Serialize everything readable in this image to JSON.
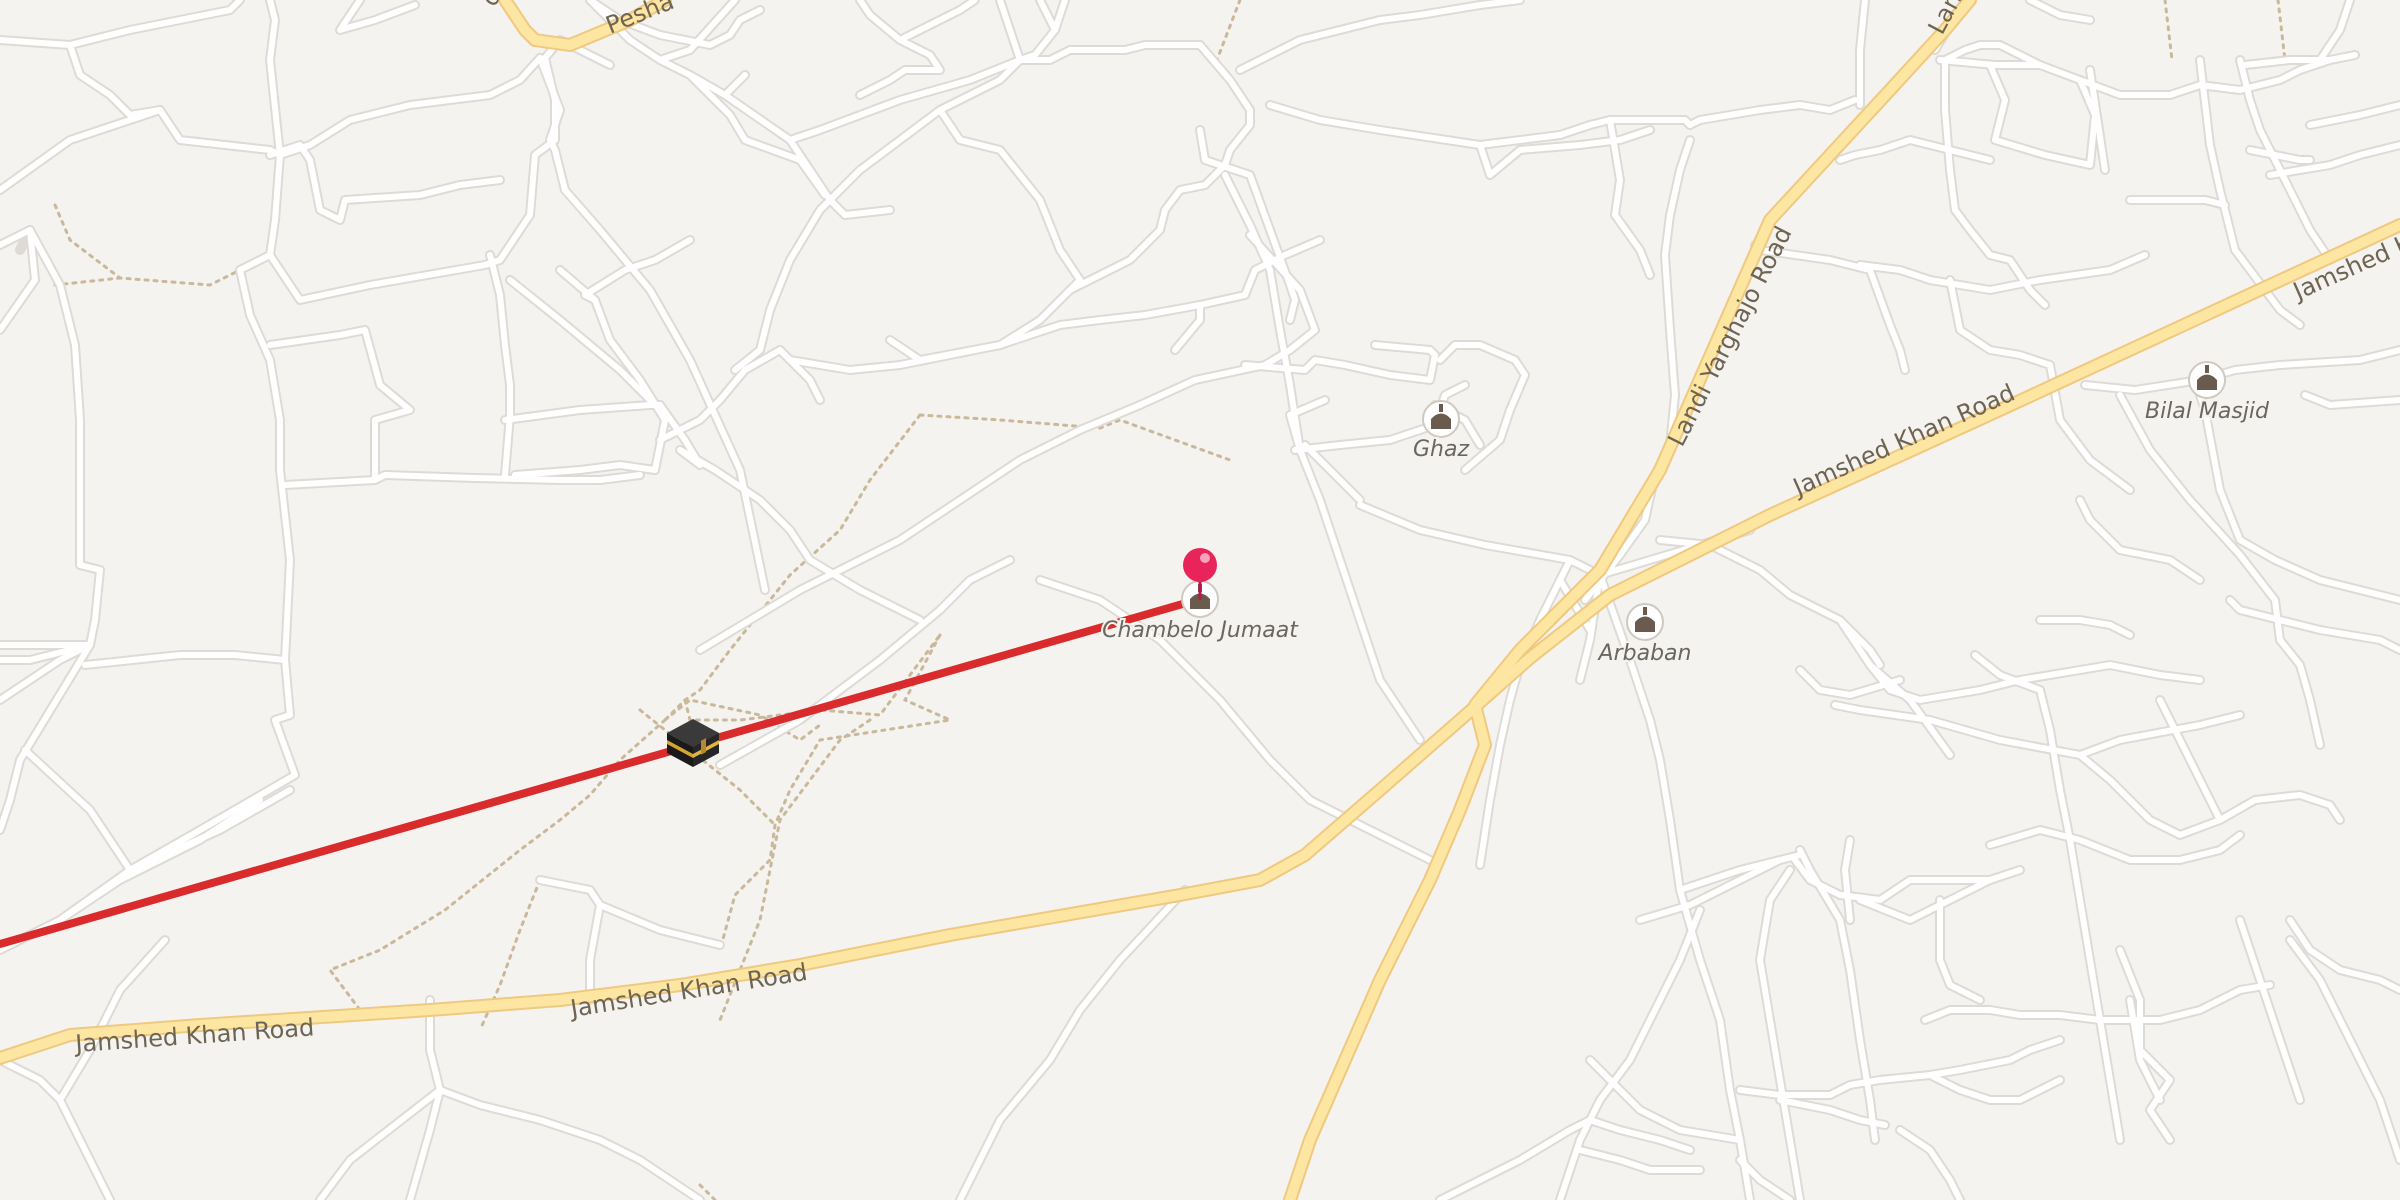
{
  "map": {
    "background_color": "#f5f3f0",
    "minor_road_color": "#ffffff",
    "minor_road_casing_color": "#dedbd6",
    "main_road_fill_color": "#fde6a2",
    "main_road_casing_color": "#efc97f",
    "path_color": "#c9b89a",
    "route_line_color": "#d92b2b",
    "pin_color": "#e8245a",
    "poi_icon_color": "#6b5a4e"
  },
  "roads": {
    "jamshed_khan_1": "Jamshed Khan Road",
    "jamshed_khan_2": "Jamshed Khan Road",
    "jamshed_khan_3": "Jamshed Khan Road",
    "jamshed_khan_4": "Jamshed K",
    "landi_yarghajo": "Landi Yarghajo Road",
    "landi_partial": "Lan",
    "peshawar_partial": "Pesha",
    "top_left_partial": "d"
  },
  "pois": [
    {
      "name": "Ghaz",
      "icon": "mosque-icon"
    },
    {
      "name": "Chambelo Jumaat",
      "icon": "mosque-icon"
    },
    {
      "name": "Arbaban",
      "icon": "mosque-icon"
    },
    {
      "name": "Bilal Masjid",
      "icon": "mosque-icon"
    }
  ],
  "markers": {
    "qibla_icon": "kaaba-icon",
    "location_pin": "location-pin-icon"
  }
}
